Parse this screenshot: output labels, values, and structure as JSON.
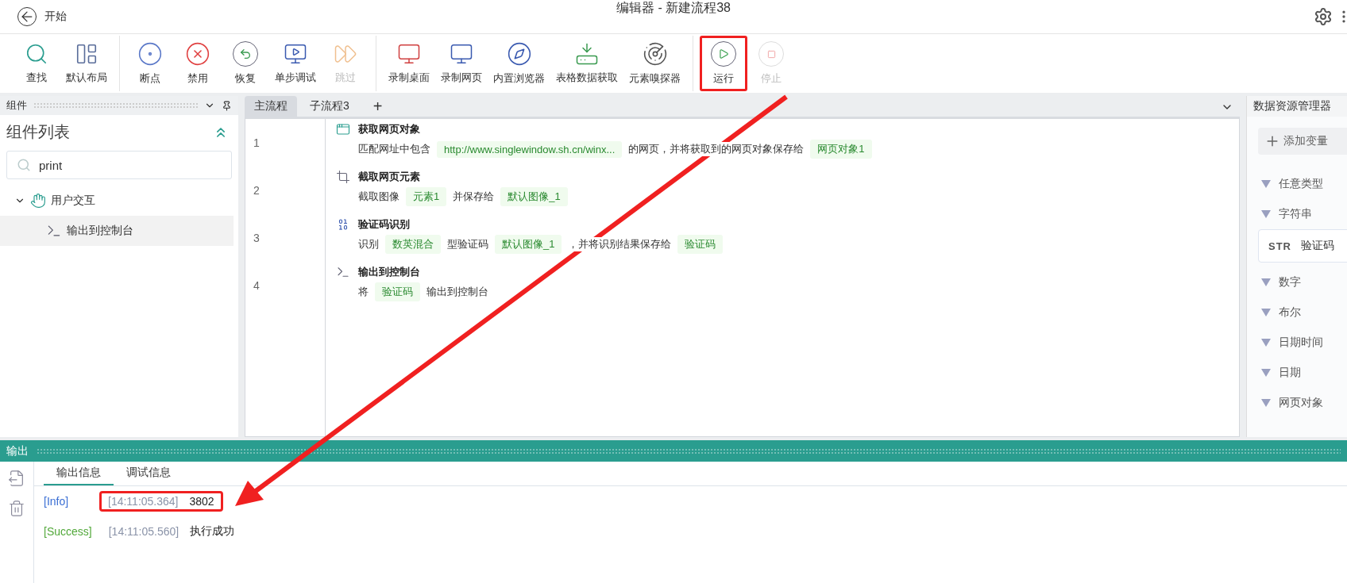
{
  "titlebar": {
    "back_label": "开始",
    "title": "编辑器 - 新建流程38"
  },
  "toolbar": {
    "groups": [
      [
        {
          "label": "查找",
          "disabled": false,
          "highlighted": false
        },
        {
          "label": "默认布局",
          "disabled": false,
          "highlighted": false
        }
      ],
      [
        {
          "label": "断点",
          "disabled": false,
          "highlighted": false
        },
        {
          "label": "禁用",
          "disabled": false,
          "highlighted": false
        },
        {
          "label": "恢复",
          "disabled": false,
          "highlighted": false
        },
        {
          "label": "单步调试",
          "disabled": false,
          "highlighted": false
        },
        {
          "label": "跳过",
          "disabled": true,
          "highlighted": false
        }
      ],
      [
        {
          "label": "录制桌面",
          "disabled": false,
          "highlighted": false
        },
        {
          "label": "录制网页",
          "disabled": false,
          "highlighted": false
        },
        {
          "label": "内置浏览器",
          "disabled": false,
          "highlighted": false
        },
        {
          "label": "表格数据获取",
          "disabled": false,
          "highlighted": false
        },
        {
          "label": "元素嗅探器",
          "disabled": false,
          "highlighted": false
        }
      ],
      [
        {
          "label": "运行",
          "disabled": false,
          "highlighted": true
        },
        {
          "label": "停止",
          "disabled": true,
          "highlighted": false
        }
      ]
    ]
  },
  "components_panel": {
    "header": "组件",
    "title": "组件列表",
    "search": {
      "value": "print"
    },
    "tree": [
      {
        "label": "用户交互",
        "expanded": true,
        "selected": false,
        "children": [
          {
            "label": "输出到控制台",
            "selected": true
          }
        ]
      }
    ]
  },
  "editor": {
    "tabs": [
      {
        "label": "主流程",
        "selected": true
      },
      {
        "label": "子流程3",
        "selected": false
      }
    ],
    "add_tab": "+",
    "steps": [
      {
        "number": "1",
        "title": "获取网页对象",
        "parts": [
          {
            "kind": "text",
            "text": "匹配网址中包含"
          },
          {
            "kind": "tag",
            "text": "http://www.singlewindow.sh.cn/winx..."
          },
          {
            "kind": "text",
            "text": "的网页，并将获取到的网页对象保存给"
          },
          {
            "kind": "tag",
            "text": "网页对象1"
          }
        ]
      },
      {
        "number": "2",
        "title": "截取网页元素",
        "parts": [
          {
            "kind": "text",
            "text": "截取图像"
          },
          {
            "kind": "tag",
            "text": "元素1"
          },
          {
            "kind": "text",
            "text": "并保存给"
          },
          {
            "kind": "tag",
            "text": "默认图像_1"
          }
        ]
      },
      {
        "number": "3",
        "title": "验证码识别",
        "parts": [
          {
            "kind": "text",
            "text": "识别"
          },
          {
            "kind": "tag",
            "text": "数英混合"
          },
          {
            "kind": "text",
            "text": "型验证码"
          },
          {
            "kind": "tag",
            "text": "默认图像_1"
          },
          {
            "kind": "text",
            "text": "，并将识别结果保存给"
          },
          {
            "kind": "tag",
            "text": "验证码"
          }
        ]
      },
      {
        "number": "4",
        "title": "输出到控制台",
        "parts": [
          {
            "kind": "text",
            "text": "将"
          },
          {
            "kind": "tag",
            "text": "验证码"
          },
          {
            "kind": "text",
            "text": "输出到控制台"
          }
        ]
      }
    ]
  },
  "data_panel": {
    "header": "数据资源管理器",
    "add_button": "添加变量",
    "groups": [
      {
        "label": "任意类型"
      },
      {
        "label": "字符串",
        "variables": [
          {
            "type": "STR",
            "name": "验证码"
          }
        ]
      },
      {
        "label": "数字"
      },
      {
        "label": "布尔"
      },
      {
        "label": "日期时间"
      },
      {
        "label": "日期"
      },
      {
        "label": "网页对象"
      }
    ]
  },
  "output": {
    "header": "输出",
    "tabs": [
      {
        "label": "输出信息",
        "selected": true
      },
      {
        "label": "调试信息",
        "selected": false
      }
    ],
    "logs": [
      {
        "level": "[Info]",
        "color": "#3b6fd4",
        "time": "[14:11:05.364]",
        "message": "3802",
        "highlighted": true
      },
      {
        "level": "[Success]",
        "color": "#52a83a",
        "time": "[14:11:05.560]",
        "message": "执行成功",
        "highlighted": false
      }
    ]
  }
}
